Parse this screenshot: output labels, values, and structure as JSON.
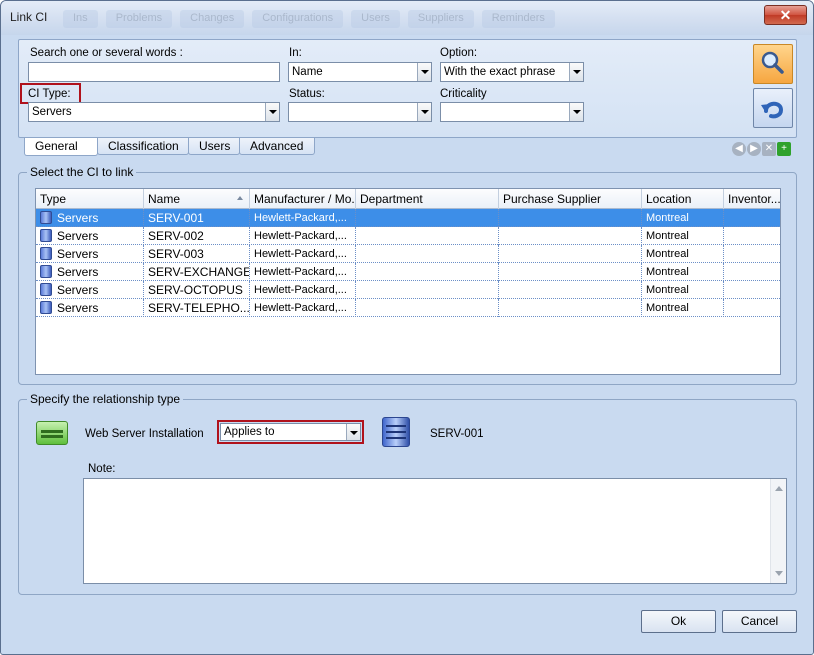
{
  "window": {
    "title": "Link CI",
    "background_menu": [
      "Ins",
      "Problems",
      "Changes",
      "Configurations",
      "Users",
      "Suppliers",
      "Reminders"
    ],
    "close_label": "✕"
  },
  "search": {
    "words_label": "Search one or several words :",
    "words_value": "",
    "in_label": "In:",
    "in_value": "Name",
    "option_label": "Option:",
    "option_value": "With the exact phrase",
    "ci_type_label": "CI Type:",
    "ci_type_value": "Servers",
    "status_label": "Status:",
    "status_value": "",
    "criticality_label": "Criticality",
    "criticality_value": "",
    "search_icon": "magnifier-icon",
    "reset_icon": "undo-icon"
  },
  "tabs": [
    "General",
    "Classification",
    "Users",
    "Advanced"
  ],
  "ci_list": {
    "group_title": "Select the CI to link",
    "columns": [
      "Type",
      "Name",
      "Manufacturer / Mo...",
      "Department",
      "Purchase Supplier",
      "Location",
      "Inventor..."
    ],
    "rows": [
      {
        "type": "Servers",
        "name": "SERV-001",
        "manufacturer": "Hewlett-Packard,...",
        "department": "",
        "supplier": "",
        "location": "Montreal",
        "inventory": ""
      },
      {
        "type": "Servers",
        "name": "SERV-002",
        "manufacturer": "Hewlett-Packard,...",
        "department": "",
        "supplier": "",
        "location": "Montreal",
        "inventory": ""
      },
      {
        "type": "Servers",
        "name": "SERV-003",
        "manufacturer": "Hewlett-Packard,...",
        "department": "",
        "supplier": "",
        "location": "Montreal",
        "inventory": ""
      },
      {
        "type": "Servers",
        "name": "SERV-EXCHANGE",
        "manufacturer": "Hewlett-Packard,...",
        "department": "",
        "supplier": "",
        "location": "Montreal",
        "inventory": ""
      },
      {
        "type": "Servers",
        "name": "SERV-OCTOPUS",
        "manufacturer": "Hewlett-Packard,...",
        "department": "",
        "supplier": "",
        "location": "Montreal",
        "inventory": ""
      },
      {
        "type": "Servers",
        "name": "SERV-TELEPHO...",
        "manufacturer": "Hewlett-Packard,...",
        "department": "",
        "supplier": "",
        "location": "Montreal",
        "inventory": ""
      }
    ],
    "selected_index": 0
  },
  "relationship": {
    "group_title": "Specify the relationship type",
    "source_label": "Web Server Installation",
    "relation_value": "Applies to",
    "target_label": "SERV-001",
    "note_label": "Note:",
    "note_value": ""
  },
  "footer": {
    "ok_label": "Ok",
    "cancel_label": "Cancel"
  }
}
